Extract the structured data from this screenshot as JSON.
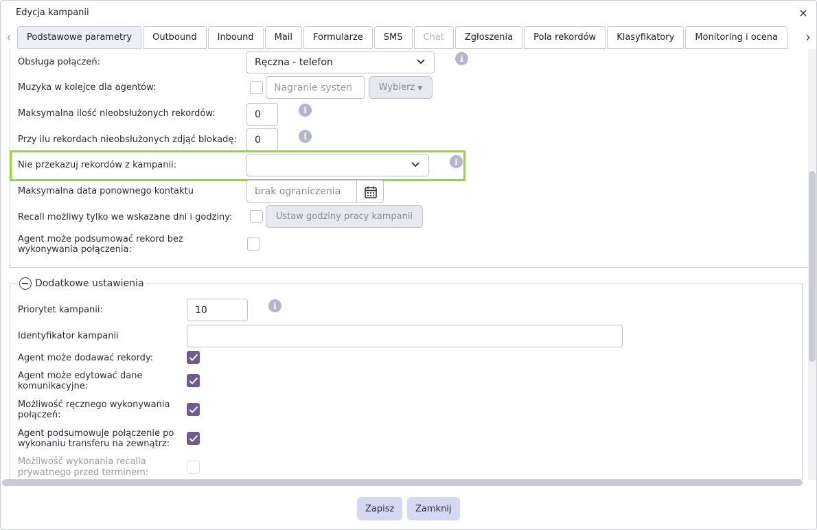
{
  "dialog": {
    "title": "Edycja kampanii"
  },
  "tabs": [
    {
      "label": "Podstawowe parametry",
      "state": "active"
    },
    {
      "label": "Outbound",
      "state": "normal"
    },
    {
      "label": "Inbound",
      "state": "normal"
    },
    {
      "label": "Mail",
      "state": "normal"
    },
    {
      "label": "Formularze",
      "state": "normal"
    },
    {
      "label": "SMS",
      "state": "normal"
    },
    {
      "label": "Chat",
      "state": "disabled"
    },
    {
      "label": "Zgłoszenia",
      "state": "normal"
    },
    {
      "label": "Pola rekordów",
      "state": "normal"
    },
    {
      "label": "Klasyfikatory",
      "state": "normal"
    },
    {
      "label": "Monitoring i ocena",
      "state": "normal"
    }
  ],
  "main_section": {
    "call_handling": {
      "label": "Obsługa połączeń:",
      "value": "Ręczna - telefon"
    },
    "agent_queue_music": {
      "label": "Muzyka w kolejce dla agentów:",
      "placeholder": "Nagranie systen",
      "button": "Wybierz"
    },
    "max_unhandled": {
      "label": "Maksymalna ilość nieobsłużonych rekordów:",
      "value": "0"
    },
    "unlock_threshold": {
      "label": "Przy ilu rekordach nieobsłużonych zdjąć blokadę:",
      "value": "0"
    },
    "do_not_transfer": {
      "label": "Nie przekazuj rekordów z kampanii:",
      "value": ""
    },
    "max_recontact_date": {
      "label": "Maksymalna data ponownego kontaktu",
      "placeholder": "brak ograniczenia"
    },
    "recall_hours": {
      "label": "Recall możliwy tylko we wskazane dni i godziny:",
      "button": "Ustaw godziny pracy kampanii"
    },
    "summarize_without_call": {
      "label_line1": "Agent może podsumować rekord bez",
      "label_line2": "wykonywania połączenia:"
    }
  },
  "extra_section": {
    "legend": "Dodatkowe ustawienia",
    "priority": {
      "label": "Priorytet kampanii:",
      "value": "10"
    },
    "campaign_id": {
      "label": "Identyfikator kampanii",
      "value": ""
    },
    "agent_add_records": {
      "label": "Agent może dodawać rekordy:",
      "checked": true
    },
    "agent_edit_comm": {
      "label_line1": "Agent może edytować dane",
      "label_line2": "komunikacyjne:",
      "checked": true
    },
    "manual_calls": {
      "label_line1": "Możliwość ręcznego wykonywania",
      "label_line2": "połączeń:",
      "checked": true
    },
    "summarize_after_transfer": {
      "label_line1": "Agent podsumowuje połączenie po",
      "label_line2": "wykonaniu transferu na zewnątrz:",
      "checked": true
    },
    "private_recall_early": {
      "label_line1": "Możliwość wykonania recalla",
      "label_line2": "prywatnego przed terminem:",
      "checked": false,
      "disabled": true
    }
  },
  "footer": {
    "save": "Zapisz",
    "close": "Zamknij"
  },
  "icons": {
    "info": "i",
    "close": "×",
    "tab_left": "‹",
    "tab_right": "›"
  },
  "colors": {
    "highlight": "#95d62f",
    "checkbox_checked": "#6e5d8c",
    "footer_button": "#d6d7f2",
    "active_tab": "#eef0f7",
    "info_icon": "#b4b6cc"
  }
}
